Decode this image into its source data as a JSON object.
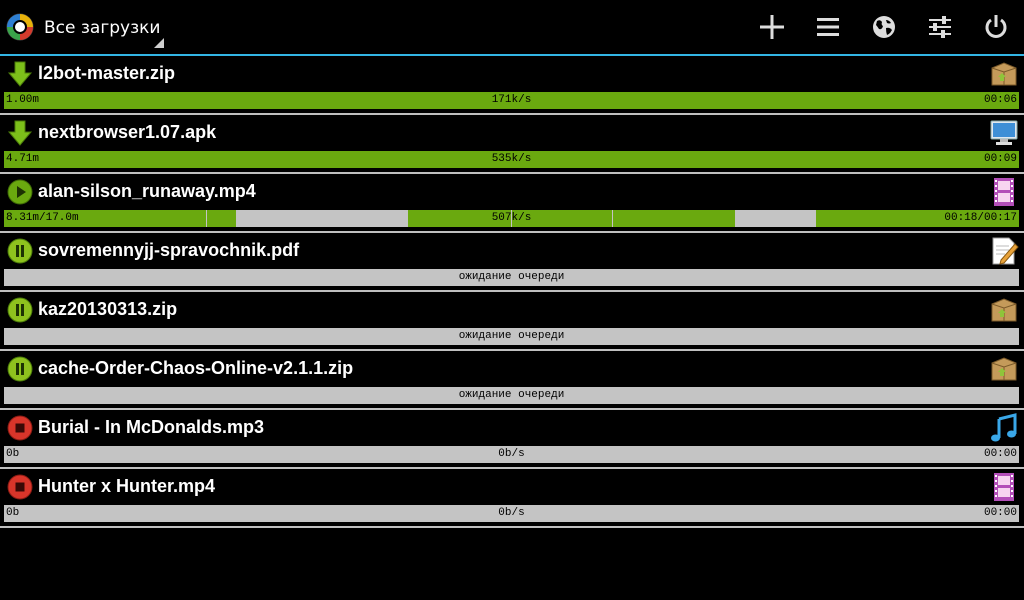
{
  "actionbar": {
    "title": "Все загрузки",
    "actions": [
      {
        "name": "add-download-button",
        "icon": "plus-icon"
      },
      {
        "name": "menu-list-button",
        "icon": "list-icon"
      },
      {
        "name": "browser-button",
        "icon": "globe-icon"
      },
      {
        "name": "settings-button",
        "icon": "sliders-icon"
      },
      {
        "name": "exit-button",
        "icon": "power-icon"
      }
    ],
    "accent_color": "#33b5e5"
  },
  "downloads": [
    {
      "name": "l2bot-master.zip",
      "status": "downloading",
      "status_icon": "download-arrow-icon",
      "type_icon": "archive-icon",
      "progress_segments": [
        [
          0,
          1
        ]
      ],
      "left": "1.00m",
      "center": "171k/s",
      "right": "00:06"
    },
    {
      "name": "nextbrowser1.07.apk",
      "status": "downloading",
      "status_icon": "download-arrow-icon",
      "type_icon": "computer-monitor-icon",
      "progress_segments": [
        [
          0,
          1
        ]
      ],
      "left": "4.71m",
      "center": "535k/s",
      "right": "00:09"
    },
    {
      "name": "alan-silson_runaway.mp4",
      "status": "playing",
      "status_icon": "play-icon",
      "type_icon": "film-icon",
      "progress_segments": [
        [
          0,
          0.199
        ],
        [
          0.2,
          0.229
        ],
        [
          0.398,
          0.499
        ],
        [
          0.5,
          0.599
        ],
        [
          0.6,
          0.72
        ],
        [
          0.8,
          1
        ]
      ],
      "left": "8.31m/17.0m",
      "center": "507k/s",
      "right": "00:18/00:17"
    },
    {
      "name": "sovremennyjj-spravochnik.pdf",
      "status": "paused",
      "status_icon": "pause-icon",
      "type_icon": "document-pencil-icon",
      "progress_segments": [],
      "left": "",
      "center": "ожидание очереди",
      "right": ""
    },
    {
      "name": "kaz20130313.zip",
      "status": "paused",
      "status_icon": "pause-icon",
      "type_icon": "archive-icon",
      "progress_segments": [],
      "left": "",
      "center": "ожидание очереди",
      "right": ""
    },
    {
      "name": "cache-Order-Chaos-Online-v2.1.1.zip",
      "status": "paused",
      "status_icon": "pause-icon",
      "type_icon": "archive-icon",
      "progress_segments": [],
      "left": "",
      "center": "ожидание очереди",
      "right": ""
    },
    {
      "name": "Burial - In McDonalds.mp3",
      "status": "stopped",
      "status_icon": "stop-icon",
      "type_icon": "music-note-icon",
      "progress_segments": [],
      "left": "0b",
      "center": "0b/s",
      "right": "00:00"
    },
    {
      "name": "Hunter x Hunter.mp4",
      "status": "stopped",
      "status_icon": "stop-icon",
      "type_icon": "film-icon",
      "progress_segments": [],
      "left": "0b",
      "center": "0b/s",
      "right": "00:00"
    }
  ],
  "colors": {
    "progress_fill": "#6aa90f",
    "progress_track": "#c4c4c4",
    "separator": "#bfbfbf"
  }
}
